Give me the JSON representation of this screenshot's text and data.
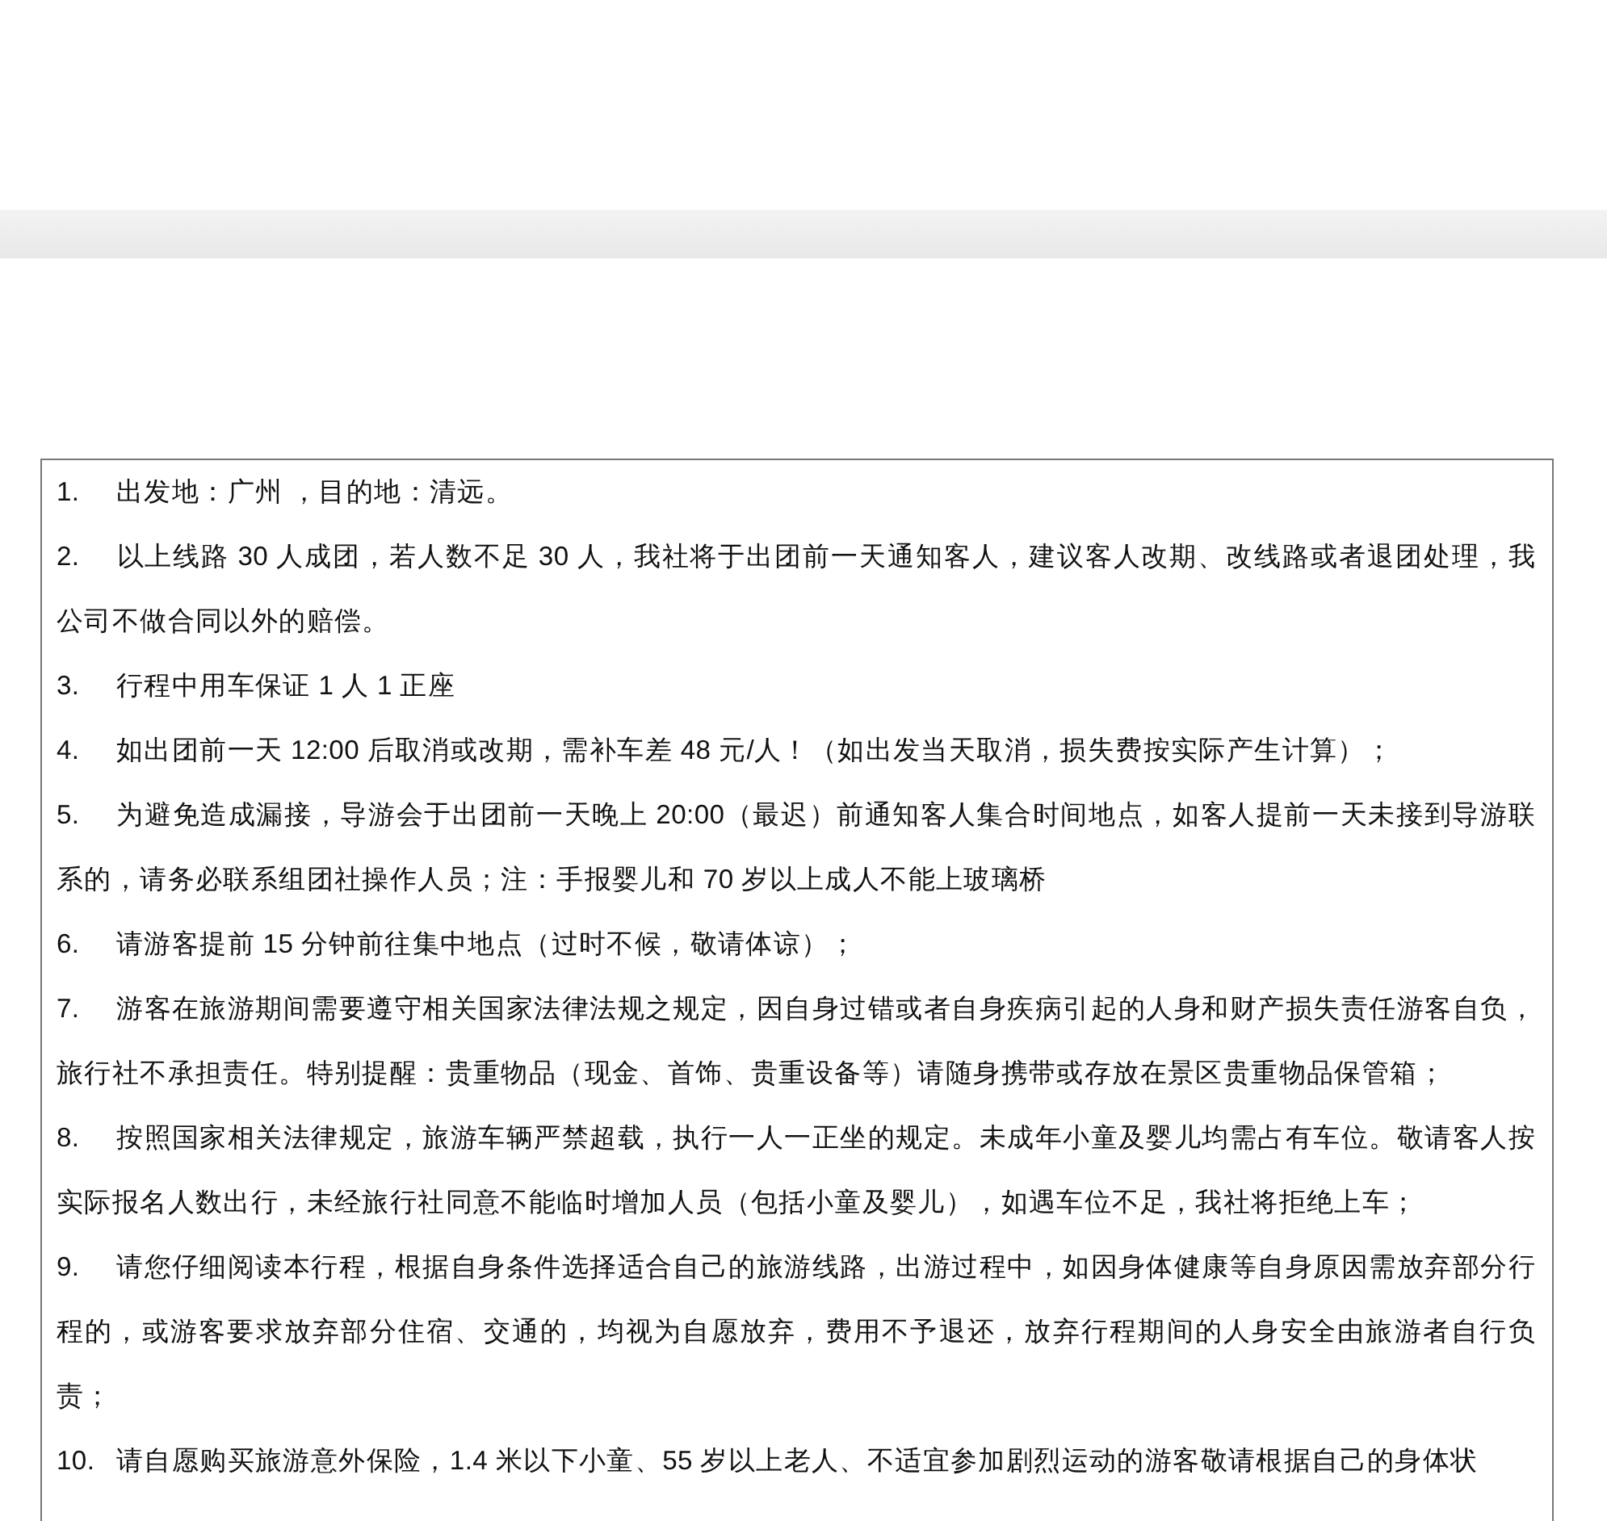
{
  "notes": [
    {
      "number": "1.",
      "text": "出发地：广州 ，目的地：清远。"
    },
    {
      "number": "2.",
      "text": "以上线路 30 人成团，若人数不足 30 人，我社将于出团前一天通知客人，建议客人改期、改线路或者退团处理，我公司不做合同以外的赔偿。"
    },
    {
      "number": "3.",
      "text": "行程中用车保证 1 人 1 正座"
    },
    {
      "number": "4.",
      "text": "如出团前一天 12:00 后取消或改期，需补车差 48 元/人！（如出发当天取消，损失费按实际产生计算）；"
    },
    {
      "number": "5.",
      "text": "为避免造成漏接，导游会于出团前一天晚上 20:00（最迟）前通知客人集合时间地点，如客人提前一天未接到导游联系的，请务必联系组团社操作人员；注：手报婴儿和 70 岁以上成人不能上玻璃桥"
    },
    {
      "number": "6.",
      "text": "请游客提前 15 分钟前往集中地点（过时不候，敬请体谅）；"
    },
    {
      "number": "7.",
      "text": "游客在旅游期间需要遵守相关国家法律法规之规定，因自身过错或者自身疾病引起的人身和财产损失责任游客自负，旅行社不承担责任。特别提醒：贵重物品（现金、首饰、贵重设备等）请随身携带或存放在景区贵重物品保管箱；"
    },
    {
      "number": "8.",
      "text": "按照国家相关法律规定，旅游车辆严禁超载，执行一人一正坐的规定。未成年小童及婴儿均需占有车位。敬请客人按实际报名人数出行，未经旅行社同意不能临时增加人员（包括小童及婴儿），如遇车位不足，我社将拒绝上车；"
    },
    {
      "number": "9.",
      "text": "请您仔细阅读本行程，根据自身条件选择适合自己的旅游线路，出游过程中，如因身体健康等自身原因需放弃部分行程的，或游客要求放弃部分住宿、交通的，均视为自愿放弃，费用不予退还，放弃行程期间的人身安全由旅游者自行负责；"
    },
    {
      "number": "10.",
      "text": "请自愿购买旅游意外保险，1.4 米以下小童、55 岁以上老人、不适宜参加剧烈运动的游客敬请根据自己的身体状"
    }
  ]
}
